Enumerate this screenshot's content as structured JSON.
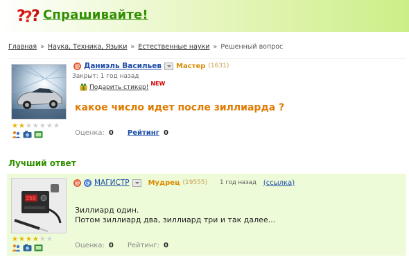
{
  "header": {
    "title": "Спрашивайте!",
    "logo_icon": "question-marks-icon"
  },
  "breadcrumb": {
    "items": [
      "Главная",
      "Наука, Техника, Языки",
      "Естественные науки"
    ],
    "current": "Решенный вопрос",
    "separator": "»"
  },
  "question": {
    "user_name": "Даниэль Васильев",
    "rank": "Мастер",
    "points": "(1631)",
    "closed": "Закрыт: 1 год назад",
    "gift_label": "Подарить стикер!",
    "new_badge": "NEW",
    "text": "какое число идет после зиллиарда ?",
    "score_label": "Оценка:",
    "score_value": "0",
    "rating_label": "Рейтинг",
    "rating_value": "0",
    "stars_filled": 2,
    "stars_total": 7
  },
  "best_answer": {
    "section_title": "Лучший ответ",
    "user_name": "МАГИСТР",
    "rank": "Мудрец",
    "points": "(19555)",
    "time": "1 год назад",
    "link_label": "(ссылка)",
    "text_line1": "Зиллиард один.",
    "text_line2": "Потом зиллиард два, зиллиард три и так далее...",
    "score_label": "Оценка:",
    "score_value": "0",
    "rating_label": "Рейтинг:",
    "rating_value": "0",
    "stars_filled": 4,
    "stars_total": 6
  },
  "colors": {
    "brand_green": "#2f8f00",
    "question_orange": "#e07b00",
    "link_blue": "#1a4aa8",
    "answer_bg": "#eefbd9"
  }
}
